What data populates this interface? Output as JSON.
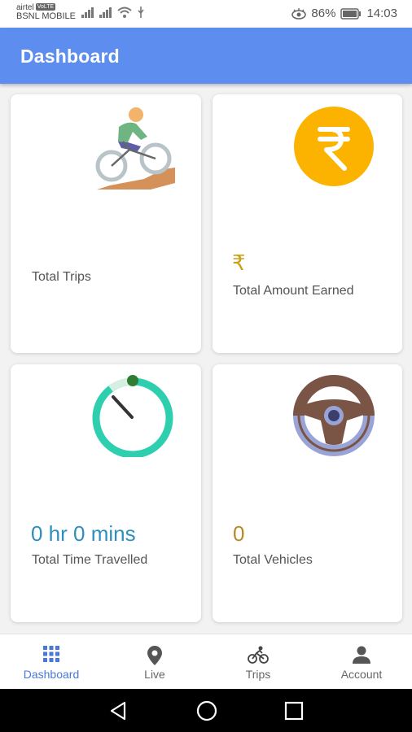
{
  "status_bar": {
    "carrier_1": "airtel",
    "carrier_1_badge": "VoLTE",
    "carrier_2": "BSNL MOBILE",
    "battery": "86%",
    "time": "14:03"
  },
  "app_bar": {
    "title": "Dashboard"
  },
  "cards": [
    {
      "icon": "cyclist-icon",
      "value": "",
      "label": "Total Trips"
    },
    {
      "icon": "rupee-coin-icon",
      "value": "₹",
      "label": "Total Amount Earned",
      "value_color": "#c9a21a"
    },
    {
      "icon": "timer-icon",
      "value": "0 hr 0 mins",
      "label": "Total Time Travelled",
      "value_color": "#2e8fbf"
    },
    {
      "icon": "steering-wheel-icon",
      "value": "0",
      "label": "Total Vehicles",
      "value_color": "#b58a2a"
    }
  ],
  "bottom_nav": {
    "items": [
      {
        "icon": "grid-icon",
        "label": "Dashboard",
        "active": true
      },
      {
        "icon": "location-pin-icon",
        "label": "Live",
        "active": false
      },
      {
        "icon": "bicycle-icon",
        "label": "Trips",
        "active": false
      },
      {
        "icon": "person-icon",
        "label": "Account",
        "active": false
      }
    ]
  },
  "colors": {
    "app_bar": "#5c8def",
    "active_nav": "#4a78d6",
    "rupee_coin": "#fcb300",
    "timer_ring": "#2ecfaf",
    "steering_outer": "#9aa3d6",
    "steering_inner": "#7a5444"
  }
}
